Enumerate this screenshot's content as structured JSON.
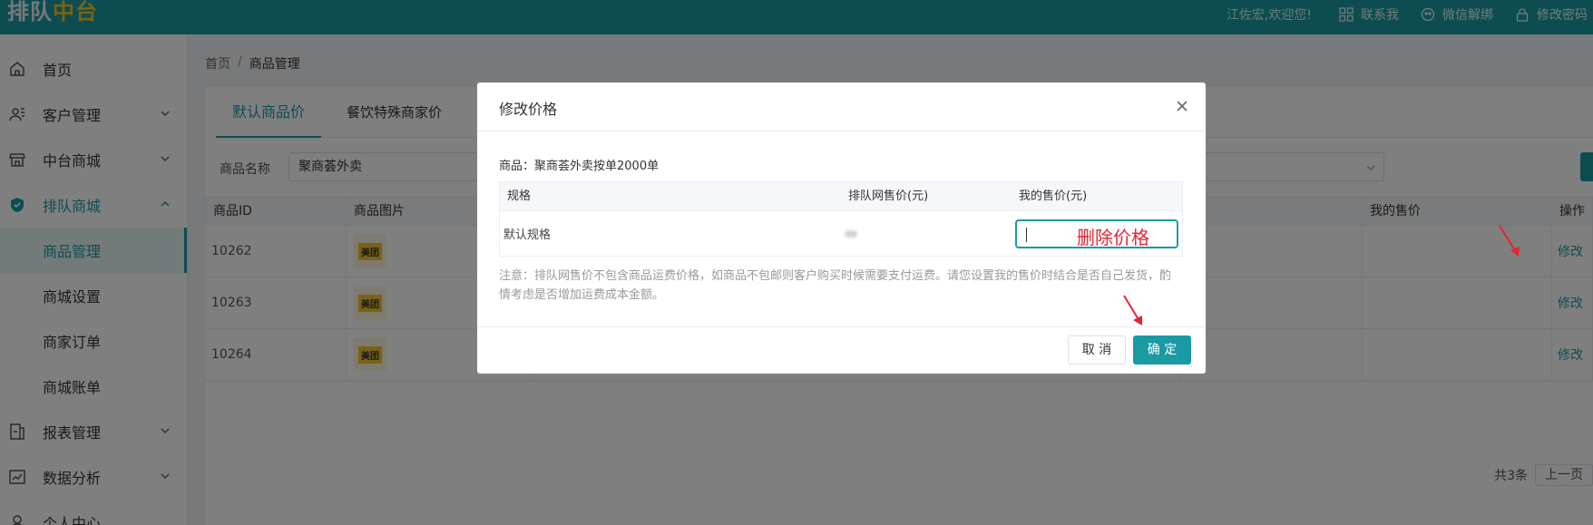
{
  "app": {
    "logo_part1": "排队",
    "logo_part2": "中台"
  },
  "header": {
    "welcome": "江佐宏,欢迎您!",
    "links": [
      {
        "label": "联系我",
        "icon": "grid-icon"
      },
      {
        "label": "微信解绑",
        "icon": "wechat-icon"
      },
      {
        "label": "修改密码",
        "icon": "lock-icon"
      }
    ]
  },
  "sidebar": {
    "items": [
      {
        "label": "首页"
      },
      {
        "label": "客户管理"
      },
      {
        "label": "中台商城"
      },
      {
        "label": "排队商城"
      },
      {
        "label": "报表管理"
      },
      {
        "label": "数据分析"
      },
      {
        "label": "个人中心"
      }
    ],
    "sub_items": [
      {
        "label": "商品管理"
      },
      {
        "label": "商城设置"
      },
      {
        "label": "商家订单"
      },
      {
        "label": "商城账单"
      }
    ]
  },
  "breadcrumb": {
    "home": "首页",
    "sep": "/",
    "current": "商品管理"
  },
  "tabs": [
    {
      "label": "默认商品价"
    },
    {
      "label": "餐饮特殊商家价"
    }
  ],
  "filter": {
    "label": "商品名称",
    "value": "聚商荟外卖"
  },
  "table": {
    "headers": [
      "商品ID",
      "商品图片",
      "我的售价",
      "操作"
    ],
    "rows": [
      {
        "id": "10262",
        "img_text": "美团",
        "action": "修改"
      },
      {
        "id": "10263",
        "img_text": "美团",
        "action": "修改"
      },
      {
        "id": "10264",
        "img_text": "美团",
        "action": "修改"
      }
    ]
  },
  "pager": {
    "total": "共3条",
    "prev": "上一页"
  },
  "modal": {
    "title": "修改价格",
    "product": "商品：聚商荟外卖按单2000单",
    "headers": [
      "规格",
      "排队网售价(元)",
      "我的售价(元)"
    ],
    "row": {
      "spec": "默认规格"
    },
    "annotation": "删除价格",
    "note": "注意：排队网售价不包含商品运费价格，如商品不包邮则客户购买时候需要支付运费。请您设置我的售价时结合是否自己发货，酌情考虑是否增加运费成本金额。",
    "cancel": "取 消",
    "confirm": "确 定"
  },
  "colors": {
    "primary": "#1a9aa3",
    "annotation": "#e8232f",
    "logo_highlight": "#f6c22b"
  }
}
